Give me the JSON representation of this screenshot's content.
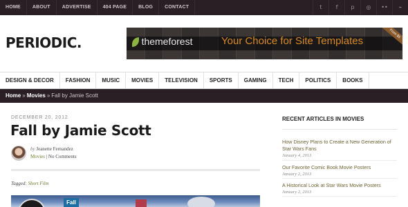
{
  "topnav": [
    "Home",
    "About",
    "Advertise",
    "404 Page",
    "Blog",
    "Contact"
  ],
  "social": [
    {
      "icon": "twitter-icon",
      "glyph": "t"
    },
    {
      "icon": "facebook-icon",
      "glyph": "f"
    },
    {
      "icon": "pinterest-icon",
      "glyph": "p"
    },
    {
      "icon": "instagram-icon",
      "glyph": "◎"
    },
    {
      "icon": "flickr-icon",
      "glyph": "••"
    },
    {
      "icon": "rss-icon",
      "glyph": "⌁"
    }
  ],
  "logo": "PERIODIC.",
  "banner": {
    "brand": "themeforest",
    "tagline": "Your Choice for Site Templates",
    "ribbon": "From $5"
  },
  "mainnav": [
    "Design & Decor",
    "Fashion",
    "Music",
    "Movies",
    "Television",
    "Sports",
    "Gaming",
    "Tech",
    "Politics",
    "Books"
  ],
  "breadcrumb": {
    "home": "Home",
    "section": "Movies",
    "current": "Fall by Jamie Scott"
  },
  "post": {
    "date": "December 20, 2012",
    "title": "Fall by Jamie Scott",
    "by": "by",
    "author": "Jeanette Fernandez",
    "category": "Movies",
    "comments": "No Comments",
    "tagged_label": "Tagged:",
    "tag": "Short Film",
    "hero_poster": "Fall"
  },
  "sidebar": {
    "heading": "Recent Articles in Movies",
    "items": [
      {
        "title": "How Disney Plans to Create a New Generation of Star Wars Fans",
        "date": "January 4, 2013"
      },
      {
        "title": "Our Favorite Comic Book Movie Posters",
        "date": "January 2, 2013"
      },
      {
        "title": "A Historical Look at Star Wars Movie Posters",
        "date": "January 2, 2013"
      }
    ]
  },
  "colors": {
    "topbar": "#2b1f26",
    "accent_link": "#6b7c2e",
    "banner_tagline": "#d98b20"
  }
}
